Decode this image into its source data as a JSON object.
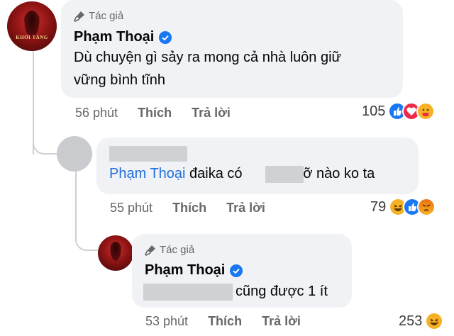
{
  "comments": [
    {
      "author_tag": "Tác giả",
      "author_name": "Phạm Thoại",
      "text_line1": "Dù chuyện gì sảy ra mong cả nhà luôn giữ",
      "text_line2": "vững bình tĩnh",
      "time": "56 phút",
      "like_label": "Thích",
      "reply_label": "Trả lời",
      "reaction_count": "105",
      "reactions": [
        "like-icon",
        "love-icon",
        "care-icon"
      ]
    },
    {
      "mention": "Phạm Thoại",
      "text_part1": "đaika có",
      "text_part2": "mỡ nào ko ta",
      "time": "55 phút",
      "like_label": "Thích",
      "reply_label": "Trả lời",
      "reaction_count": "79",
      "reactions": [
        "haha-icon",
        "like-icon",
        "angry-icon"
      ]
    },
    {
      "author_tag": "Tác giả",
      "author_name": "Phạm Thoại",
      "text": "cũng được 1 ít",
      "time": "53 phút",
      "like_label": "Thích",
      "reply_label": "Trả lời",
      "reaction_count": "253",
      "reactions": [
        "haha-icon"
      ]
    }
  ],
  "colors": {
    "bubble": "#f0f2f5",
    "mention": "#216fdb",
    "meta": "#65676b",
    "verified": "#1877f2"
  }
}
